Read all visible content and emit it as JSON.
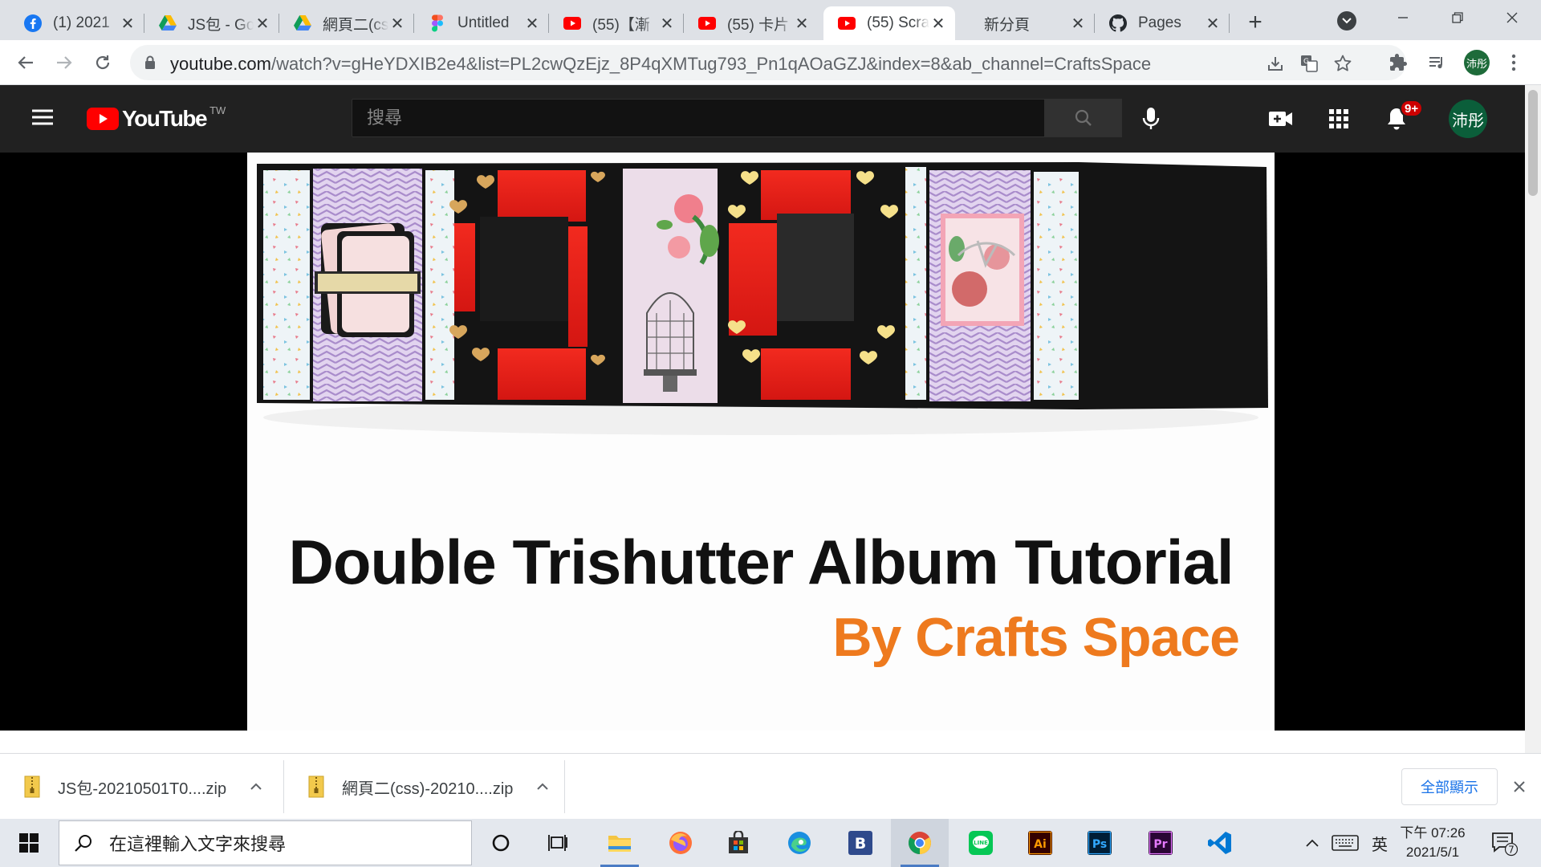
{
  "tabs": [
    {
      "title": "(1) 2021",
      "favicon": "facebook-icon"
    },
    {
      "title": "JS包 - Go",
      "favicon": "google-drive-icon"
    },
    {
      "title": "網頁二(cs",
      "favicon": "google-drive-icon"
    },
    {
      "title": "Untitled",
      "favicon": "figma-icon"
    },
    {
      "title": "(55)【漸",
      "favicon": "youtube-icon"
    },
    {
      "title": "(55) 卡片",
      "favicon": "youtube-icon"
    },
    {
      "title": "(55) Scra",
      "favicon": "youtube-icon",
      "active": true
    },
    {
      "title": "新分頁",
      "favicon": ""
    },
    {
      "title": "Pages",
      "favicon": "github-icon"
    }
  ],
  "toolbar": {
    "url_host": "youtube.com",
    "url_path": "/watch?v=gHeYDXIB2e4&list=PL2cwQzEjz_8P4qXMTug793_Pn1qAOaGZJ&index=8&ab_channel=CraftsSpace",
    "profile_initials": "沛彤"
  },
  "youtube": {
    "logo_text": "YouTube",
    "country_code": "TW",
    "search_placeholder": "搜尋",
    "notification_count": "9+",
    "avatar_initials": "沛彤"
  },
  "video": {
    "title": "Double Trishutter Album Tutorial",
    "subtitle": "By Crafts Space"
  },
  "downloads": {
    "items": [
      {
        "name": "JS包-20210501T0....zip"
      },
      {
        "name": "網頁二(css)-20210....zip"
      }
    ],
    "show_all_label": "全部顯示"
  },
  "taskbar": {
    "search_placeholder": "在這裡輸入文字來搜尋",
    "ime_label": "英",
    "clock_time": "下午 07:26",
    "clock_date": "2021/5/1",
    "notification_count": "7"
  },
  "colors": {
    "youtube_red": "#ff0000",
    "subtitle_orange": "#ee7a1e",
    "chrome_blue": "#1a73e8"
  }
}
